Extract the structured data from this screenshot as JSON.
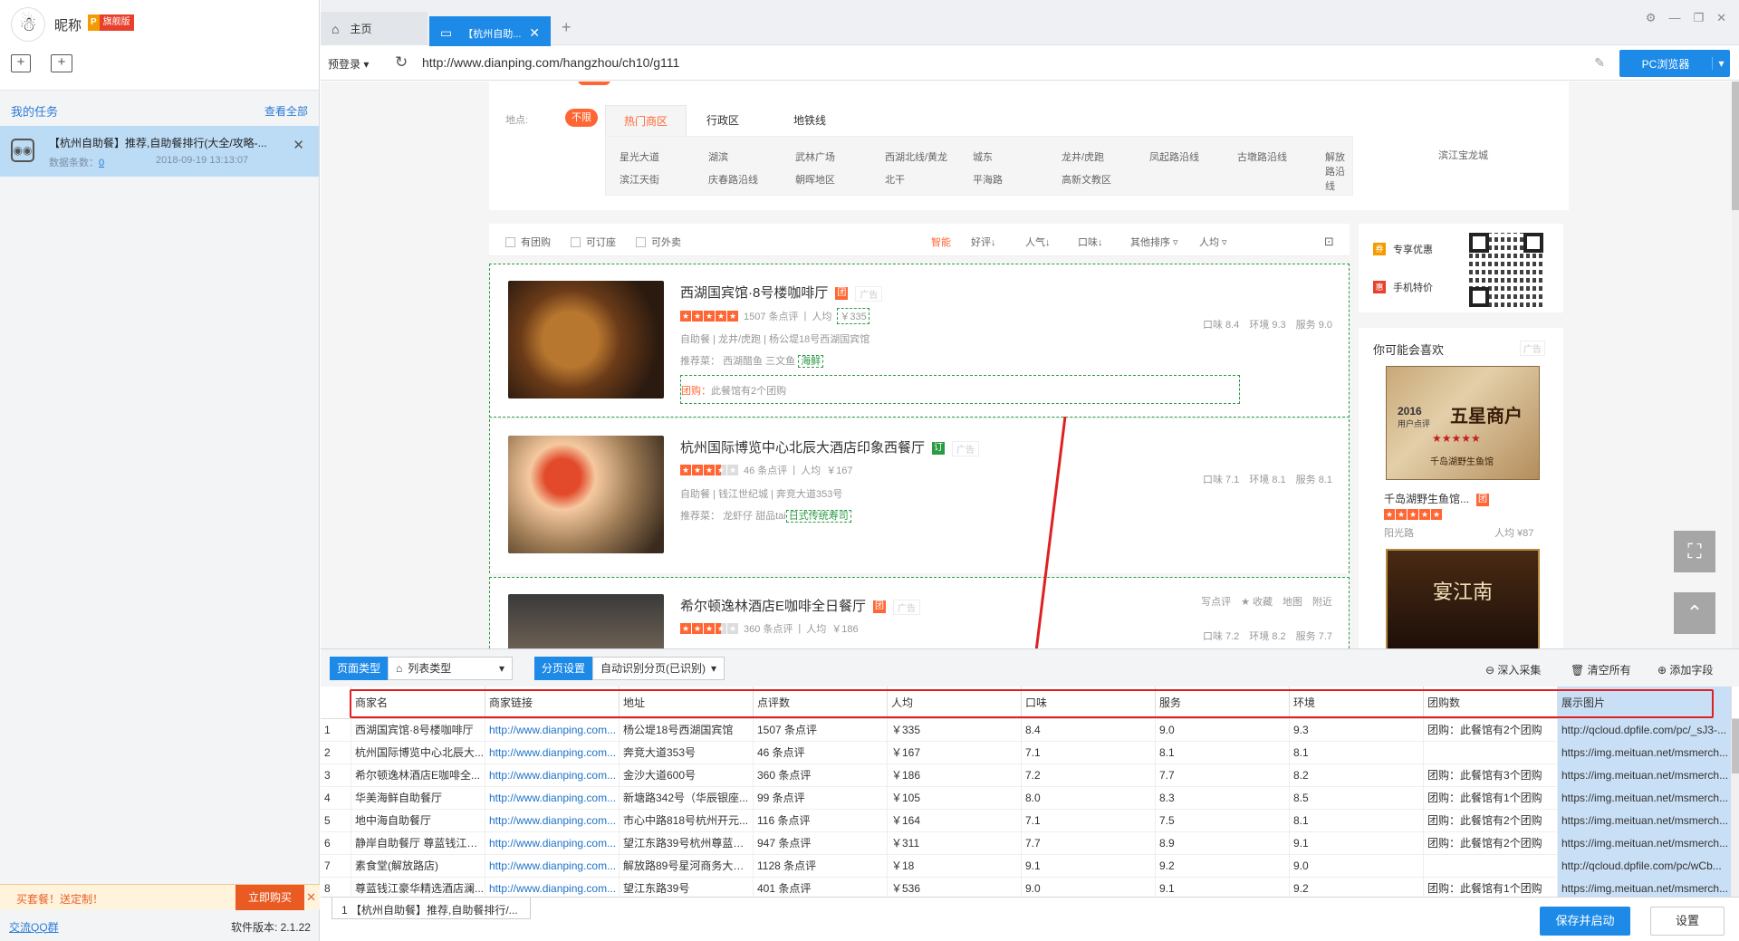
{
  "user": {
    "nickname": "昵称",
    "vip_p": "P",
    "vip_tag": "旗舰版"
  },
  "tasks": {
    "header": "我的任务",
    "view_all": "查看全部",
    "items": [
      {
        "title": "【杭州自助餐】推荐,自助餐排行(大全/攻略-...",
        "count_label": "数据条数：",
        "count": "0",
        "time": "2018-09-19 13:13:07"
      }
    ]
  },
  "promo": {
    "text": "买套餐！送定制！",
    "button": "立即购买"
  },
  "footer": {
    "qq": "交流QQ群",
    "version": "软件版本: 2.1.22"
  },
  "browser": {
    "tabs": [
      {
        "label": "主页"
      },
      {
        "label": "【杭州自助..."
      }
    ],
    "pre_login": "预登录",
    "url": "http://www.dianping.com/hangzhou/ch10/g111",
    "pc_button": "PC浏览器"
  },
  "web": {
    "filter_label": "地点:",
    "chip": "不限",
    "filter_tabs": [
      "热门商区",
      "行政区",
      "地铁线"
    ],
    "areas": [
      "星光大道",
      "湖滨",
      "武林广场",
      "西湖北线/黄龙",
      "城东",
      "龙井/虎跑",
      "凤起路沿线",
      "古墩路沿线",
      "解放路沿线",
      "滨江宝龙城",
      "滨江天街",
      "庆春路沿线",
      "朝晖地区",
      "北干",
      "平海路",
      "高新文教区"
    ],
    "checkboxes": [
      "有团购",
      "可订座",
      "可外卖"
    ],
    "sorts": [
      "智能",
      "好评↓",
      "人气↓",
      "口味↓",
      "其他排序",
      "人均"
    ],
    "shops": [
      {
        "name": "西湖国宾馆·8号楼咖啡厅",
        "badge": "团",
        "ad": "广告",
        "stars": 5,
        "reviews": "1507 条点评",
        "avg_label": "人均",
        "avg": "￥335",
        "cat": "自助餐",
        "region": "龙井/虎跑",
        "addr": "杨公堤18号西湖国宾馆",
        "rec_label": "推荐菜：",
        "rec": "西湖醋鱼 三文鱼",
        "rec_hl": "海鲜",
        "group_label": "团购：",
        "group": "此餐馆有2个团购",
        "scores": "口味 8.4　环境 9.3　服务 9.0"
      },
      {
        "name": "杭州国际博览中心北辰大酒店印象西餐厅",
        "badge": "订",
        "ad": "广告",
        "stars": 3.5,
        "reviews": "46 条点评",
        "avg_label": "人均",
        "avg": "￥167",
        "cat": "自助餐",
        "region": "钱江世纪城",
        "addr": "奔竞大道353号",
        "rec_label": "推荐菜：",
        "rec": "龙虾仔 甜品tai",
        "rec_hl": "日式传统寿司",
        "scores": "口味 7.1　环境 8.1　服务 8.1"
      },
      {
        "name": "希尔顿逸林酒店E咖啡全日餐厅",
        "badge": "团",
        "ad": "广告",
        "stars": 3.5,
        "reviews": "360 条点评",
        "avg_label": "人均",
        "avg": "￥186",
        "actions": "写点评　★ 收藏　地图　附近",
        "scores": "口味 7.2　环境 8.2　服务 7.7"
      }
    ],
    "side": {
      "coupon": "专享优惠",
      "phone": "手机特价",
      "like_title": "你可能会喜欢",
      "ad": "广告",
      "rec_name": "千岛湖野生鱼馆...",
      "rec_badge": "团",
      "rec_place": "阳光路",
      "rec_avg": "人均 ¥87",
      "award_year": "2016",
      "award_sub": "用户点评",
      "award_title": "五星商户",
      "award_name": "千岛湖野生鱼馆",
      "award2": "宴江南"
    }
  },
  "toolbar": {
    "page_type_k": "页面类型",
    "page_type_v": "列表类型",
    "paging_k": "分页设置",
    "paging_v": "自动识别分页(已识别)",
    "deep": "深入采集",
    "clear": "清空所有",
    "add_field": "添加字段"
  },
  "grid": {
    "headers": [
      "商家名",
      "商家链接",
      "地址",
      "点评数",
      "人均",
      "口味",
      "服务",
      "环境",
      "团购数",
      "展示图片"
    ],
    "rows": [
      [
        "西湖国宾馆·8号楼咖啡厅",
        "http://www.dianping.com...",
        "杨公堤18号西湖国宾馆",
        "1507 条点评",
        "￥335",
        "8.4",
        "9.0",
        "9.3",
        "团购：此餐馆有2个团购",
        "http://qcloud.dpfile.com/pc/_sJ3-..."
      ],
      [
        "杭州国际博览中心北辰大...",
        "http://www.dianping.com...",
        "奔竞大道353号",
        "46 条点评",
        "￥167",
        "7.1",
        "8.1",
        "8.1",
        "",
        "https://img.meituan.net/msmerch..."
      ],
      [
        "希尔顿逸林酒店E咖啡全...",
        "http://www.dianping.com...",
        "金沙大道600号",
        "360 条点评",
        "￥186",
        "7.2",
        "7.7",
        "8.2",
        "团购：此餐馆有3个团购",
        "https://img.meituan.net/msmerch..."
      ],
      [
        "华美海鲜自助餐厅",
        "http://www.dianping.com...",
        "新塘路342号（华辰银座...",
        "99 条点评",
        "￥105",
        "8.0",
        "8.3",
        "8.5",
        "团购：此餐馆有1个团购",
        "https://img.meituan.net/msmerch..."
      ],
      [
        "地中海自助餐厅",
        "http://www.dianping.com...",
        "市心中路818号杭州开元...",
        "116 条点评",
        "￥164",
        "7.1",
        "7.5",
        "8.1",
        "团购：此餐馆有2个团购",
        "https://img.meituan.net/msmerch..."
      ],
      [
        "静岸自助餐厅 尊蓝钱江豪...",
        "http://www.dianping.com...",
        "望江东路39号杭州尊蓝钱...",
        "947 条点评",
        "￥311",
        "7.7",
        "8.9",
        "9.1",
        "团购：此餐馆有2个团购",
        "https://img.meituan.net/msmerch..."
      ],
      [
        "素食堂(解放路店)",
        "http://www.dianping.com...",
        "解放路89号星河商务大厦...",
        "1128 条点评",
        "￥18",
        "9.1",
        "9.2",
        "9.0",
        "",
        "http://qcloud.dpfile.com/pc/wCb..."
      ],
      [
        "尊蓝钱江豪华精选酒店澜...",
        "http://www.dianping.com...",
        "望江东路39号",
        "401 条点评",
        "￥536",
        "9.0",
        "9.1",
        "9.2",
        "团购：此餐馆有1个团购",
        "https://img.meituan.net/msmerch..."
      ]
    ]
  },
  "bottom": {
    "tab": "1 【杭州自助餐】推荐,自助餐排行/...",
    "save": "保存并启动",
    "settings": "设置"
  },
  "colors": {
    "accent": "#1e8ae8",
    "orange": "#ff6633",
    "highlight_red": "#e02020"
  }
}
